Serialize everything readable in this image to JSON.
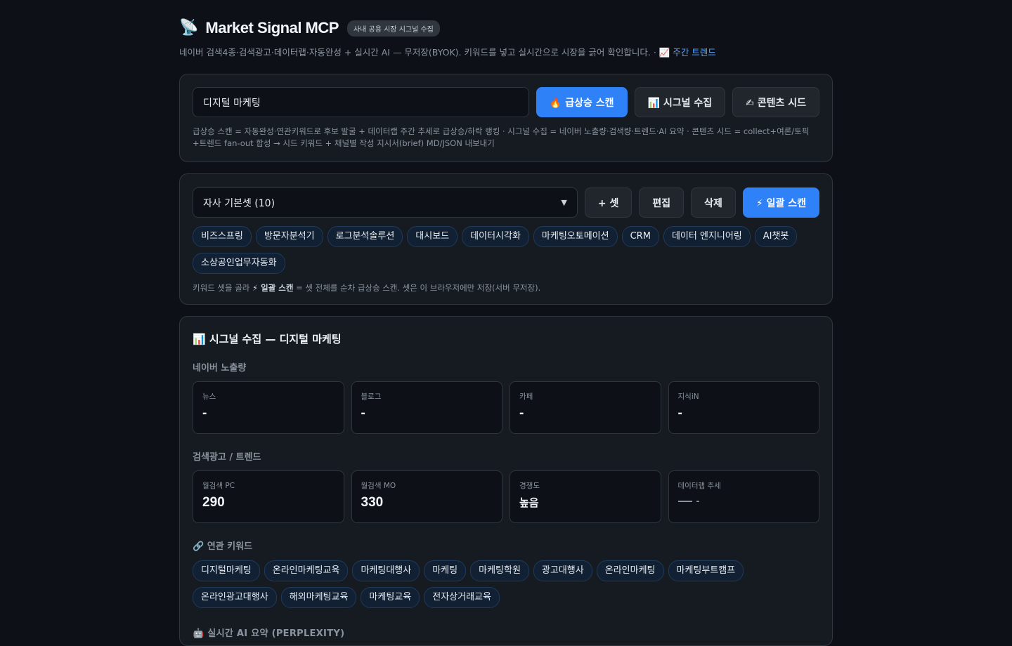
{
  "header": {
    "icon": "📡",
    "title": "Market Signal MCP",
    "badge": "사내 공용 시장 시그널 수집",
    "subtitle": "네이버 검색4종·검색광고·데이터랩·자동완성 + 실시간 AI — 무저장(BYOK). 키워드를 넣고 실시간으로 시장을 긁어 확인합니다. · ",
    "trend_link": "📈 주간 트렌드"
  },
  "search": {
    "keyword_value": "디지털 마케팅",
    "surge_button": "🔥 급상승 스캔",
    "collect_button": "📊 시그널 수집",
    "seed_button": "✍ 콘텐츠 시드",
    "help": "급상승 스캔 = 자동완성·연관키워드로 후보 발굴 + 데이터랩 주간 추세로 급상승/하락 랭킹 · 시그널 수집 = 네이버 노출량·검색량·트렌드·AI 요약 · 콘텐츠 시드 = collect+여론/토픽+트렌드 fan-out 합성 → 시드 키워드 + 채널별 작성 지시서(brief) MD/JSON 내보내기"
  },
  "sets": {
    "selected": "자사 기본셋 (10)",
    "add_button": "+ 셋",
    "edit_button": "편집",
    "delete_button": "삭제",
    "batch_button": "⚡ 일괄 스캔",
    "keywords": [
      "비즈스프링",
      "방문자분석기",
      "로그분석솔루션",
      "대시보드",
      "데이터시각화",
      "마케팅오토메이션",
      "CRM",
      "데이터 엔지니어링",
      "AI챗봇",
      "소상공인업무자동화"
    ],
    "help_prefix": "키워드 셋을 골라 ",
    "help_bold": "⚡ 일괄 스캔",
    "help_suffix": " = 셋 전체를 순차 급상승 스캔. 셋은 이 브라우저에만 저장(서버 무저장)."
  },
  "signal": {
    "title": "📊 시그널 수집 — 디지털 마케팅",
    "exposure_head": "네이버 노출량",
    "exposure": [
      {
        "label": "뉴스",
        "value": "-"
      },
      {
        "label": "블로그",
        "value": "-"
      },
      {
        "label": "카페",
        "value": "-"
      },
      {
        "label": "지식iN",
        "value": "-"
      }
    ],
    "ads_head": "검색광고 / 트렌드",
    "ads": {
      "pc_label": "월검색 PC",
      "pc_value": "290",
      "mo_label": "월검색 MO",
      "mo_value": "330",
      "comp_label": "경쟁도",
      "comp_value": "높음",
      "trend_label": "데이터랩 추세",
      "trend_value": "-"
    },
    "related_head": "🔗 연관 키워드",
    "related": [
      "디지털마케팅",
      "온라인마케팅교육",
      "마케팅대행사",
      "마케팅",
      "마케팅학원",
      "광고대행사",
      "온라인마케팅",
      "마케팅부트캠프",
      "온라인광고대행사",
      "해외마케팅교육",
      "마케팅교육",
      "전자상거래교육"
    ],
    "ai_head": "🤖 실시간 AI 요약 (PERPLEXITY)"
  },
  "colors": {
    "background": "#0d1117",
    "card": "#161b22",
    "accent": "#2f81f7",
    "chip_bg": "#122034"
  }
}
